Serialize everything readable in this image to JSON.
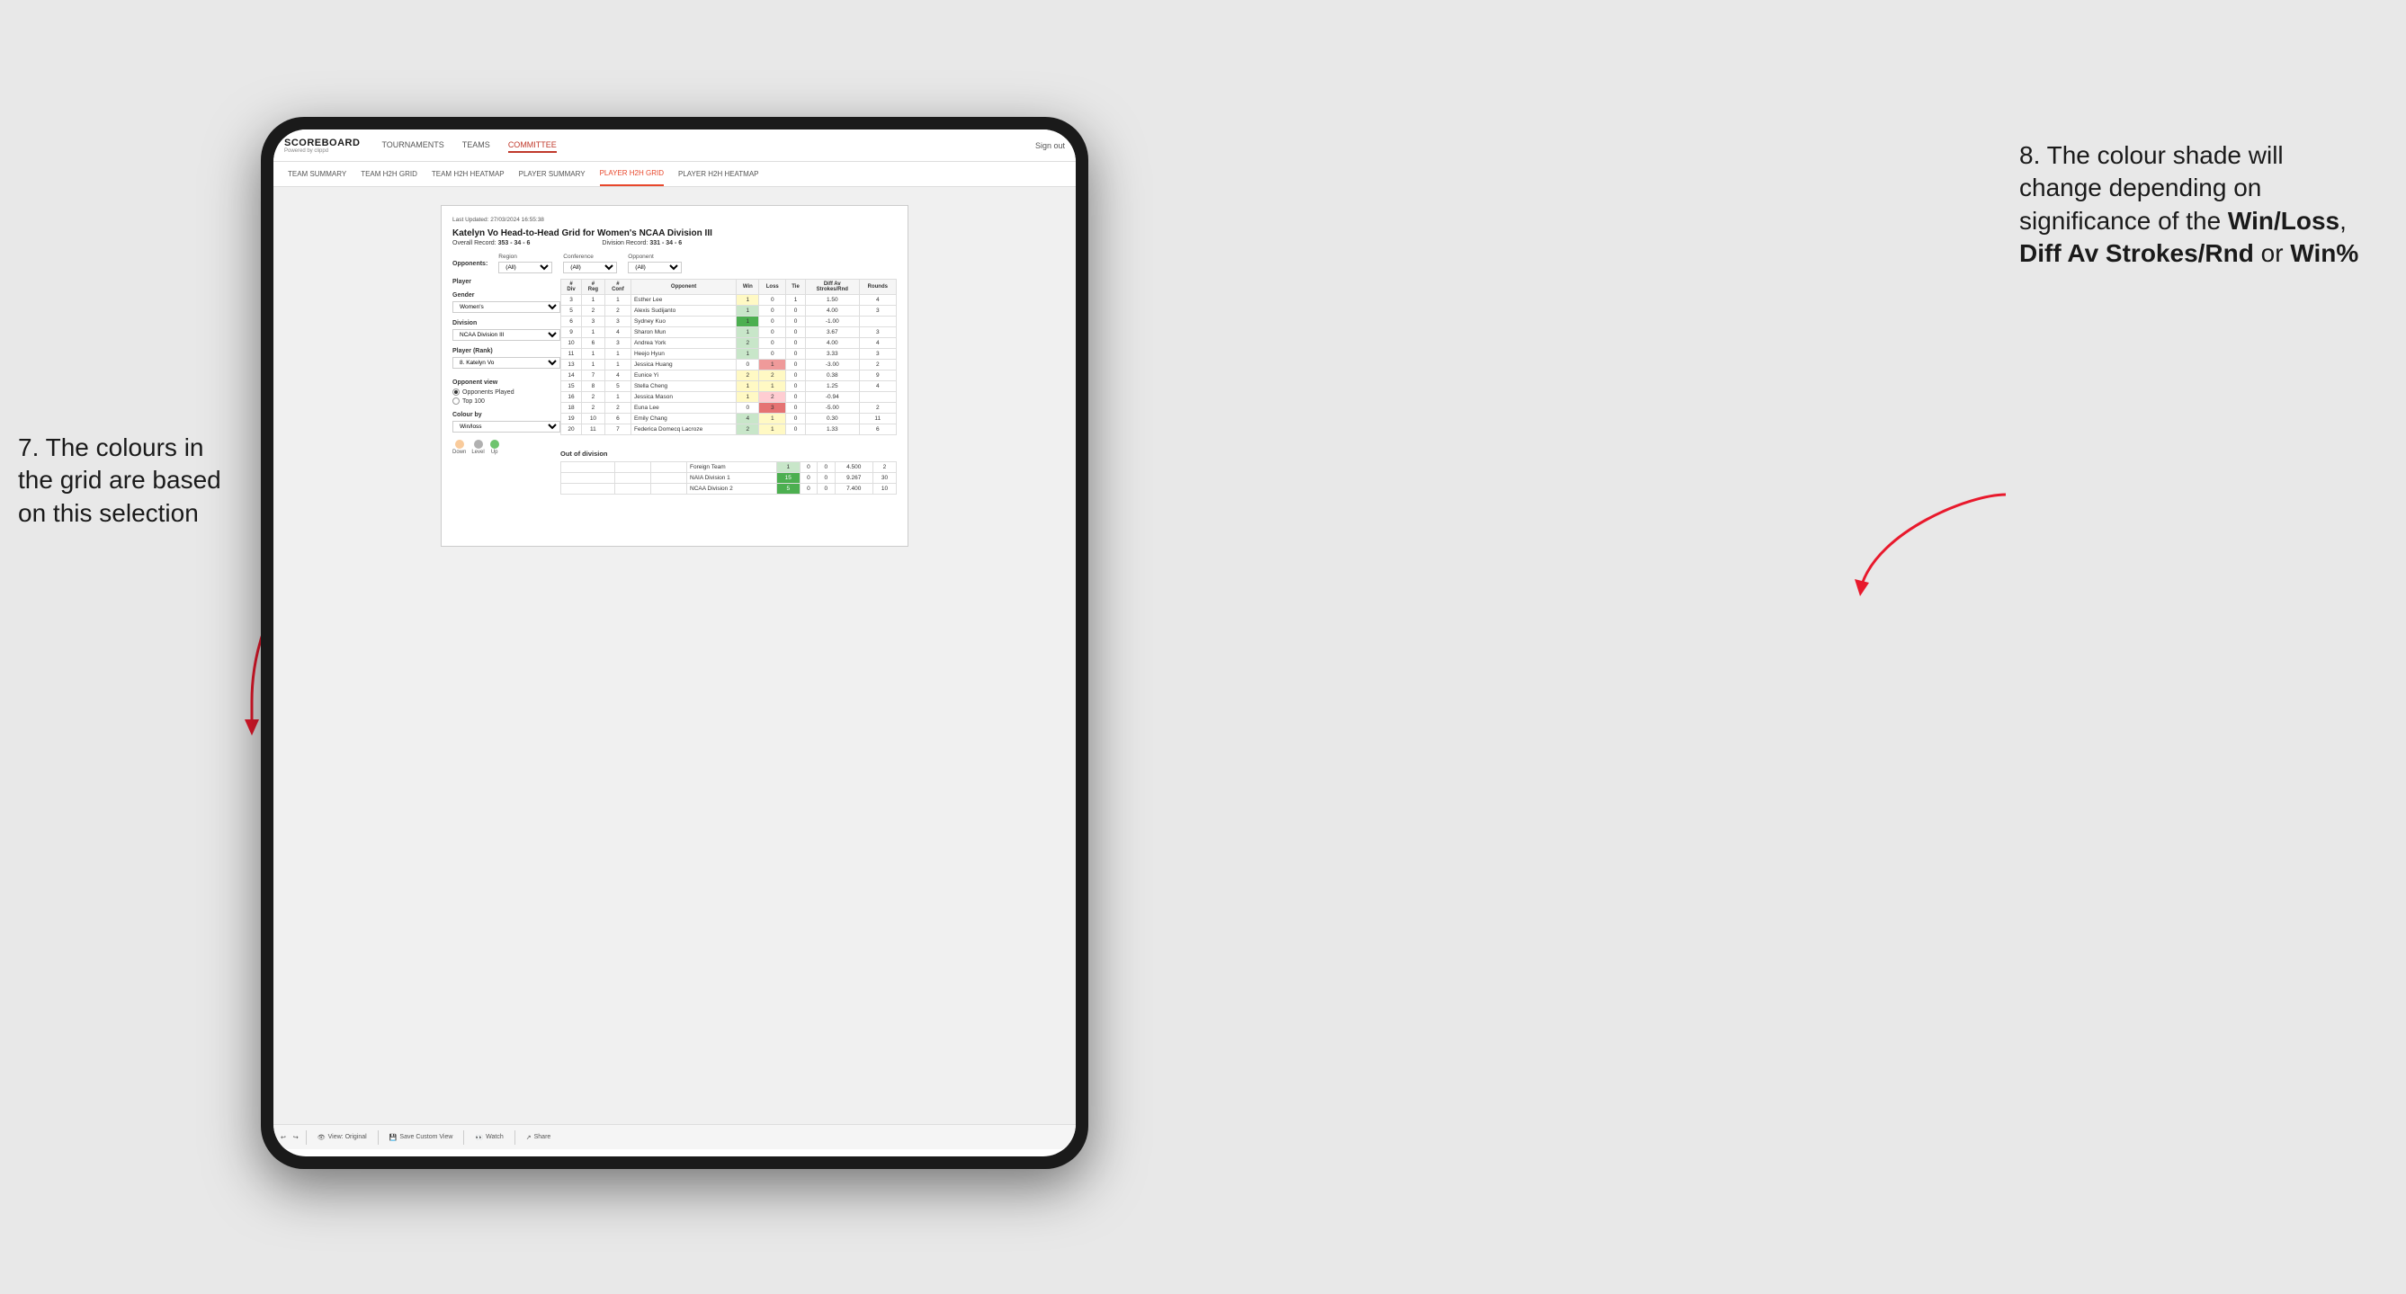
{
  "background": "#e8e8e8",
  "annotations": {
    "left_text": "7. The colours in the grid are based on this selection",
    "right_text_1": "8. The colour shade will change depending on significance of the ",
    "right_bold_1": "Win/Loss",
    "right_text_2": ", ",
    "right_bold_2": "Diff Av Strokes/Rnd",
    "right_text_3": " or ",
    "right_bold_3": "Win%"
  },
  "nav": {
    "logo": "SCOREBOARD",
    "logo_sub": "Powered by clippd",
    "items": [
      "TOURNAMENTS",
      "TEAMS",
      "COMMITTEE"
    ],
    "active": "COMMITTEE",
    "sign_out": "Sign out"
  },
  "sub_nav": {
    "items": [
      "TEAM SUMMARY",
      "TEAM H2H GRID",
      "TEAM H2H HEATMAP",
      "PLAYER SUMMARY",
      "PLAYER H2H GRID",
      "PLAYER H2H HEATMAP"
    ],
    "active": "PLAYER H2H GRID"
  },
  "report": {
    "last_updated": "Last Updated: 27/03/2024 16:55:38",
    "title": "Katelyn Vo Head-to-Head Grid for Women's NCAA Division III",
    "overall_record_label": "Overall Record:",
    "overall_record": "353 - 34 - 6",
    "division_record_label": "Division Record:",
    "division_record": "331 - 34 - 6",
    "filters": {
      "opponents_label": "Opponents:",
      "region_label": "Region",
      "region_value": "(All)",
      "conference_label": "Conference",
      "conference_value": "(All)",
      "opponent_label": "Opponent",
      "opponent_value": "(All)"
    },
    "left_panel": {
      "player_label": "Player",
      "gender_label": "Gender",
      "gender_value": "Women's",
      "division_label": "Division",
      "division_value": "NCAA Division III",
      "player_rank_label": "Player (Rank)",
      "player_rank_value": "8. Katelyn Vo",
      "opponent_view_label": "Opponent view",
      "opponent_view_options": [
        "Opponents Played",
        "Top 100"
      ],
      "opponent_view_selected": "Opponents Played",
      "colour_by_label": "Colour by",
      "colour_by_value": "Win/loss",
      "legend": {
        "down_label": "Down",
        "level_label": "Level",
        "up_label": "Up"
      }
    },
    "table_headers": {
      "div": "#\nDiv",
      "reg": "#\nReg",
      "conf": "#\nConf",
      "opponent": "Opponent",
      "win": "Win",
      "loss": "Loss",
      "tie": "Tie",
      "diff_av": "Diff Av\nStrokes/Rnd",
      "rounds": "Rounds"
    },
    "rows": [
      {
        "div": 3,
        "reg": 1,
        "conf": 1,
        "opponent": "Esther Lee",
        "win": 1,
        "loss": 0,
        "tie": 1,
        "diff_av": 1.5,
        "rounds": 4,
        "win_color": "yellow",
        "loss_color": "white"
      },
      {
        "div": 5,
        "reg": 2,
        "conf": 2,
        "opponent": "Alexis Sudijanto",
        "win": 1,
        "loss": 0,
        "tie": 0,
        "diff_av": 4.0,
        "rounds": 3,
        "win_color": "green-light",
        "loss_color": "white"
      },
      {
        "div": 6,
        "reg": 3,
        "conf": 3,
        "opponent": "Sydney Kuo",
        "win": 1,
        "loss": 0,
        "tie": 0,
        "diff_av": -1.0,
        "rounds": "",
        "win_color": "green-dark",
        "loss_color": "white"
      },
      {
        "div": 9,
        "reg": 1,
        "conf": 4,
        "opponent": "Sharon Mun",
        "win": 1,
        "loss": 0,
        "tie": 0,
        "diff_av": 3.67,
        "rounds": 3,
        "win_color": "green-light",
        "loss_color": "white"
      },
      {
        "div": 10,
        "reg": 6,
        "conf": 3,
        "opponent": "Andrea York",
        "win": 2,
        "loss": 0,
        "tie": 0,
        "diff_av": 4.0,
        "rounds": 4,
        "win_color": "green-light",
        "loss_color": "white"
      },
      {
        "div": 11,
        "reg": 1,
        "conf": 1,
        "opponent": "Heejo Hyun",
        "win": 1,
        "loss": 0,
        "tie": 0,
        "diff_av": 3.33,
        "rounds": 3,
        "win_color": "green-light",
        "loss_color": "white"
      },
      {
        "div": 13,
        "reg": 1,
        "conf": 1,
        "opponent": "Jessica Huang",
        "win": 0,
        "loss": 1,
        "tie": 0,
        "diff_av": -3.0,
        "rounds": 2,
        "win_color": "white",
        "loss_color": "red-mid"
      },
      {
        "div": 14,
        "reg": 7,
        "conf": 4,
        "opponent": "Eunice Yi",
        "win": 2,
        "loss": 2,
        "tie": 0,
        "diff_av": 0.38,
        "rounds": 9,
        "win_color": "yellow",
        "loss_color": "yellow"
      },
      {
        "div": 15,
        "reg": 8,
        "conf": 5,
        "opponent": "Stella Cheng",
        "win": 1,
        "loss": 1,
        "tie": 0,
        "diff_av": 1.25,
        "rounds": 4,
        "win_color": "yellow",
        "loss_color": "yellow"
      },
      {
        "div": 16,
        "reg": 2,
        "conf": 1,
        "opponent": "Jessica Mason",
        "win": 1,
        "loss": 2,
        "tie": 0,
        "diff_av": -0.94,
        "rounds": "",
        "win_color": "yellow",
        "loss_color": "red-light"
      },
      {
        "div": 18,
        "reg": 2,
        "conf": 2,
        "opponent": "Euna Lee",
        "win": 0,
        "loss": 3,
        "tie": 0,
        "diff_av": -5.0,
        "rounds": 2,
        "win_color": "white",
        "loss_color": "red-dark"
      },
      {
        "div": 19,
        "reg": 10,
        "conf": 6,
        "opponent": "Emily Chang",
        "win": 4,
        "loss": 1,
        "tie": 0,
        "diff_av": 0.3,
        "rounds": 11,
        "win_color": "green-light",
        "loss_color": "yellow"
      },
      {
        "div": 20,
        "reg": 11,
        "conf": 7,
        "opponent": "Federica Domecq Lacroze",
        "win": 2,
        "loss": 1,
        "tie": 0,
        "diff_av": 1.33,
        "rounds": 6,
        "win_color": "green-light",
        "loss_color": "yellow"
      }
    ],
    "out_of_division": {
      "label": "Out of division",
      "rows": [
        {
          "opponent": "Foreign Team",
          "win": 1,
          "loss": 0,
          "tie": 0,
          "diff_av": 4.5,
          "rounds": 2,
          "win_color": "green-light"
        },
        {
          "opponent": "NAIA Division 1",
          "win": 15,
          "loss": 0,
          "tie": 0,
          "diff_av": 9.267,
          "rounds": 30,
          "win_color": "green-dark"
        },
        {
          "opponent": "NCAA Division 2",
          "win": 5,
          "loss": 0,
          "tie": 0,
          "diff_av": 7.4,
          "rounds": 10,
          "win_color": "green-dark"
        }
      ]
    }
  },
  "toolbar": {
    "view_original": "View: Original",
    "save_custom_view": "Save Custom View",
    "watch": "Watch",
    "share": "Share"
  }
}
